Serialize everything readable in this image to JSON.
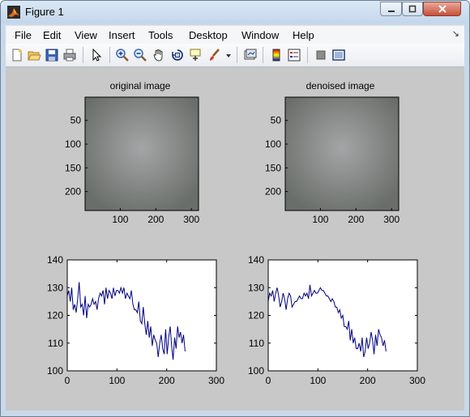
{
  "window": {
    "title": "Figure 1"
  },
  "menubar": [
    "File",
    "Edit",
    "View",
    "Insert",
    "Tools",
    "Desktop",
    "Window",
    "Help"
  ],
  "toolbar": {
    "icons": [
      "new-figure-icon",
      "open-file-icon",
      "save-icon",
      "print-icon",
      "pointer-icon",
      "zoom-in-icon",
      "zoom-out-icon",
      "pan-hand-icon",
      "rotate-3d-icon",
      "data-cursor-icon",
      "brush-icon",
      "brush-dropdown-icon",
      "link-plot-icon",
      "colorbar-icon",
      "legend-icon",
      "hide-plot-tools-icon",
      "show-plot-tools-icon"
    ]
  },
  "plots": {
    "image1": {
      "title": "original image",
      "xticks": [
        "100",
        "200",
        "300"
      ],
      "yticks": [
        "50",
        "100",
        "150",
        "200"
      ],
      "xlim": [
        1,
        320
      ],
      "ylim": [
        1,
        240
      ],
      "colors": {
        "center": "#a3a6a6",
        "edge": "#6a6e6a"
      }
    },
    "image2": {
      "title": "denoised image",
      "xticks": [
        "100",
        "200",
        "300"
      ],
      "yticks": [
        "50",
        "100",
        "150",
        "200"
      ],
      "xlim": [
        1,
        320
      ],
      "ylim": [
        1,
        240
      ],
      "colors": {
        "center": "#a3a6a6",
        "edge": "#6a6e6a"
      }
    }
  },
  "chart_data": [
    {
      "type": "line",
      "title": "",
      "xlim": [
        0,
        300
      ],
      "ylim": [
        100,
        140
      ],
      "xticks": [
        "0",
        "100",
        "200",
        "300"
      ],
      "yticks": [
        "100",
        "110",
        "120",
        "130",
        "140"
      ],
      "color": "#000080",
      "x": [
        0,
        3,
        6,
        9,
        12,
        15,
        18,
        21,
        24,
        27,
        30,
        33,
        36,
        39,
        42,
        45,
        48,
        51,
        54,
        57,
        60,
        63,
        66,
        69,
        72,
        75,
        78,
        81,
        84,
        87,
        90,
        93,
        96,
        99,
        102,
        105,
        108,
        111,
        114,
        117,
        120,
        123,
        126,
        129,
        132,
        135,
        138,
        141,
        144,
        147,
        150,
        153,
        156,
        159,
        162,
        165,
        168,
        171,
        174,
        177,
        180,
        183,
        186,
        189,
        192,
        195,
        198,
        201,
        204,
        207,
        210,
        213,
        216,
        219,
        222,
        225,
        228,
        231,
        234,
        237
      ],
      "y": [
        127,
        129,
        125,
        130,
        122,
        124,
        121,
        126,
        132,
        123,
        124,
        120,
        127,
        119,
        124,
        123,
        124,
        126,
        124,
        125,
        122,
        126,
        128,
        127,
        129,
        124,
        130,
        126,
        129,
        128,
        126,
        130,
        127,
        129,
        129,
        128,
        130,
        128,
        130,
        126,
        128,
        127,
        126,
        129,
        124,
        122,
        122,
        121,
        125,
        118,
        117,
        123,
        117,
        113,
        118,
        112,
        116,
        109,
        113,
        111,
        110,
        105,
        110,
        113,
        108,
        106,
        115,
        106,
        112,
        116,
        109,
        104,
        112,
        108,
        116,
        112,
        114,
        110,
        113,
        107
      ]
    },
    {
      "type": "line",
      "title": "",
      "xlim": [
        0,
        300
      ],
      "ylim": [
        100,
        140
      ],
      "xticks": [
        "0",
        "100",
        "200",
        "300"
      ],
      "yticks": [
        "100",
        "110",
        "120",
        "130",
        "140"
      ],
      "color": "#000080",
      "x": [
        0,
        3,
        6,
        9,
        12,
        15,
        18,
        21,
        24,
        27,
        30,
        33,
        36,
        39,
        42,
        45,
        48,
        51,
        54,
        57,
        60,
        63,
        66,
        69,
        72,
        75,
        78,
        81,
        84,
        87,
        90,
        93,
        96,
        99,
        102,
        105,
        108,
        111,
        114,
        117,
        120,
        123,
        126,
        129,
        132,
        135,
        138,
        141,
        144,
        147,
        150,
        153,
        156,
        159,
        162,
        165,
        168,
        171,
        174,
        177,
        180,
        183,
        186,
        189,
        192,
        195,
        198,
        201,
        204,
        207,
        210,
        213,
        216,
        219,
        222,
        225,
        228,
        231,
        234,
        237
      ],
      "y": [
        125,
        128,
        127,
        129,
        125,
        128,
        130,
        127,
        123,
        125,
        128,
        126,
        122,
        126,
        128,
        127,
        123,
        124,
        125,
        125,
        126,
        127,
        126,
        126,
        128,
        127,
        128,
        126,
        131,
        127,
        128,
        129,
        128,
        128,
        129,
        130,
        129,
        129,
        128,
        127,
        127,
        126,
        125,
        126,
        125,
        123,
        123,
        121,
        122,
        119,
        120,
        116,
        116,
        115,
        118,
        111,
        115,
        110,
        112,
        108,
        108,
        110,
        107,
        112,
        105,
        107,
        112,
        108,
        110,
        114,
        111,
        106,
        113,
        109,
        115,
        113,
        112,
        109,
        111,
        107
      ]
    }
  ]
}
